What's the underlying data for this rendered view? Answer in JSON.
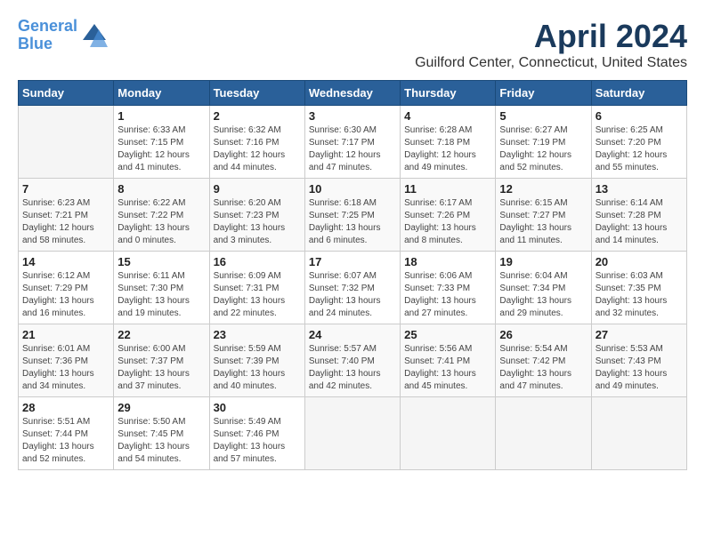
{
  "header": {
    "logo_line1": "General",
    "logo_line2": "Blue",
    "month_title": "April 2024",
    "location": "Guilford Center, Connecticut, United States"
  },
  "days_of_week": [
    "Sunday",
    "Monday",
    "Tuesday",
    "Wednesday",
    "Thursday",
    "Friday",
    "Saturday"
  ],
  "weeks": [
    [
      {
        "day": "",
        "info": ""
      },
      {
        "day": "1",
        "info": "Sunrise: 6:33 AM\nSunset: 7:15 PM\nDaylight: 12 hours\nand 41 minutes."
      },
      {
        "day": "2",
        "info": "Sunrise: 6:32 AM\nSunset: 7:16 PM\nDaylight: 12 hours\nand 44 minutes."
      },
      {
        "day": "3",
        "info": "Sunrise: 6:30 AM\nSunset: 7:17 PM\nDaylight: 12 hours\nand 47 minutes."
      },
      {
        "day": "4",
        "info": "Sunrise: 6:28 AM\nSunset: 7:18 PM\nDaylight: 12 hours\nand 49 minutes."
      },
      {
        "day": "5",
        "info": "Sunrise: 6:27 AM\nSunset: 7:19 PM\nDaylight: 12 hours\nand 52 minutes."
      },
      {
        "day": "6",
        "info": "Sunrise: 6:25 AM\nSunset: 7:20 PM\nDaylight: 12 hours\nand 55 minutes."
      }
    ],
    [
      {
        "day": "7",
        "info": "Sunrise: 6:23 AM\nSunset: 7:21 PM\nDaylight: 12 hours\nand 58 minutes."
      },
      {
        "day": "8",
        "info": "Sunrise: 6:22 AM\nSunset: 7:22 PM\nDaylight: 13 hours\nand 0 minutes."
      },
      {
        "day": "9",
        "info": "Sunrise: 6:20 AM\nSunset: 7:23 PM\nDaylight: 13 hours\nand 3 minutes."
      },
      {
        "day": "10",
        "info": "Sunrise: 6:18 AM\nSunset: 7:25 PM\nDaylight: 13 hours\nand 6 minutes."
      },
      {
        "day": "11",
        "info": "Sunrise: 6:17 AM\nSunset: 7:26 PM\nDaylight: 13 hours\nand 8 minutes."
      },
      {
        "day": "12",
        "info": "Sunrise: 6:15 AM\nSunset: 7:27 PM\nDaylight: 13 hours\nand 11 minutes."
      },
      {
        "day": "13",
        "info": "Sunrise: 6:14 AM\nSunset: 7:28 PM\nDaylight: 13 hours\nand 14 minutes."
      }
    ],
    [
      {
        "day": "14",
        "info": "Sunrise: 6:12 AM\nSunset: 7:29 PM\nDaylight: 13 hours\nand 16 minutes."
      },
      {
        "day": "15",
        "info": "Sunrise: 6:11 AM\nSunset: 7:30 PM\nDaylight: 13 hours\nand 19 minutes."
      },
      {
        "day": "16",
        "info": "Sunrise: 6:09 AM\nSunset: 7:31 PM\nDaylight: 13 hours\nand 22 minutes."
      },
      {
        "day": "17",
        "info": "Sunrise: 6:07 AM\nSunset: 7:32 PM\nDaylight: 13 hours\nand 24 minutes."
      },
      {
        "day": "18",
        "info": "Sunrise: 6:06 AM\nSunset: 7:33 PM\nDaylight: 13 hours\nand 27 minutes."
      },
      {
        "day": "19",
        "info": "Sunrise: 6:04 AM\nSunset: 7:34 PM\nDaylight: 13 hours\nand 29 minutes."
      },
      {
        "day": "20",
        "info": "Sunrise: 6:03 AM\nSunset: 7:35 PM\nDaylight: 13 hours\nand 32 minutes."
      }
    ],
    [
      {
        "day": "21",
        "info": "Sunrise: 6:01 AM\nSunset: 7:36 PM\nDaylight: 13 hours\nand 34 minutes."
      },
      {
        "day": "22",
        "info": "Sunrise: 6:00 AM\nSunset: 7:37 PM\nDaylight: 13 hours\nand 37 minutes."
      },
      {
        "day": "23",
        "info": "Sunrise: 5:59 AM\nSunset: 7:39 PM\nDaylight: 13 hours\nand 40 minutes."
      },
      {
        "day": "24",
        "info": "Sunrise: 5:57 AM\nSunset: 7:40 PM\nDaylight: 13 hours\nand 42 minutes."
      },
      {
        "day": "25",
        "info": "Sunrise: 5:56 AM\nSunset: 7:41 PM\nDaylight: 13 hours\nand 45 minutes."
      },
      {
        "day": "26",
        "info": "Sunrise: 5:54 AM\nSunset: 7:42 PM\nDaylight: 13 hours\nand 47 minutes."
      },
      {
        "day": "27",
        "info": "Sunrise: 5:53 AM\nSunset: 7:43 PM\nDaylight: 13 hours\nand 49 minutes."
      }
    ],
    [
      {
        "day": "28",
        "info": "Sunrise: 5:51 AM\nSunset: 7:44 PM\nDaylight: 13 hours\nand 52 minutes."
      },
      {
        "day": "29",
        "info": "Sunrise: 5:50 AM\nSunset: 7:45 PM\nDaylight: 13 hours\nand 54 minutes."
      },
      {
        "day": "30",
        "info": "Sunrise: 5:49 AM\nSunset: 7:46 PM\nDaylight: 13 hours\nand 57 minutes."
      },
      {
        "day": "",
        "info": ""
      },
      {
        "day": "",
        "info": ""
      },
      {
        "day": "",
        "info": ""
      },
      {
        "day": "",
        "info": ""
      }
    ]
  ]
}
